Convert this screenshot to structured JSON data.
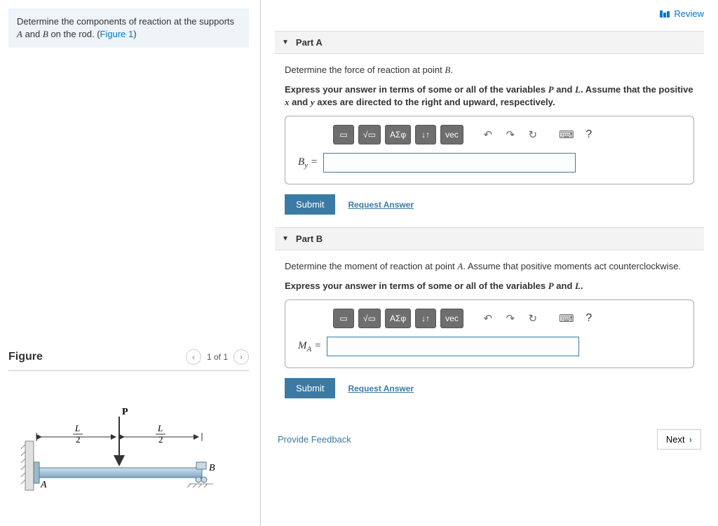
{
  "intro": {
    "pre": "Determine the components of reaction at the supports ",
    "mid": " and ",
    "post": " on the rod. (",
    "var_a": "A",
    "var_b": "B",
    "figlink": "Figure 1",
    "close": ")"
  },
  "figure": {
    "title": "Figure",
    "pager": "1 of 1",
    "labels": {
      "P": "P",
      "A": "A",
      "B": "B",
      "L2a": "L",
      "L2b": "L",
      "two": "2"
    }
  },
  "review": "Review",
  "parts": [
    {
      "title": "Part A",
      "prompt_pre": "Determine the force of reaction at point ",
      "prompt_var": "B",
      "prompt_post": ".",
      "instr_pre": "Express your answer in terms of some or all of the variables ",
      "instr_v1": "P",
      "instr_mid": " and ",
      "instr_v2": "L",
      "instr_post1": ". Assume that the positive ",
      "instr_v3": "x",
      "instr_mid2": " and ",
      "instr_v4": "y",
      "instr_post2": " axes are directed to the right and upward, respectively.",
      "label_main": "B",
      "label_sub": "y",
      "eq": " =",
      "submit": "Submit",
      "request": "Request Answer"
    },
    {
      "title": "Part B",
      "prompt_pre": "Determine the moment of reaction at point ",
      "prompt_var": "A",
      "prompt_post": ". Assume that positive moments act counterclockwise.",
      "instr_pre": "Express your answer in terms of some or all of the variables ",
      "instr_v1": "P",
      "instr_mid": " and ",
      "instr_v2": "L",
      "instr_post1": ".",
      "instr_v3": "",
      "instr_mid2": "",
      "instr_v4": "",
      "instr_post2": "",
      "label_main": "M",
      "label_sub": "A",
      "eq": " =",
      "submit": "Submit",
      "request": "Request Answer"
    }
  ],
  "toolbar": {
    "templates": "▭",
    "sqrt": "√▭",
    "greek": "ΑΣφ",
    "arrows": "↓↑",
    "vec": "vec",
    "undo": "↶",
    "redo": "↷",
    "reset": "↻",
    "keyboard": "⌨",
    "help": "?"
  },
  "footer": {
    "feedback": "Provide Feedback",
    "next": "Next"
  }
}
